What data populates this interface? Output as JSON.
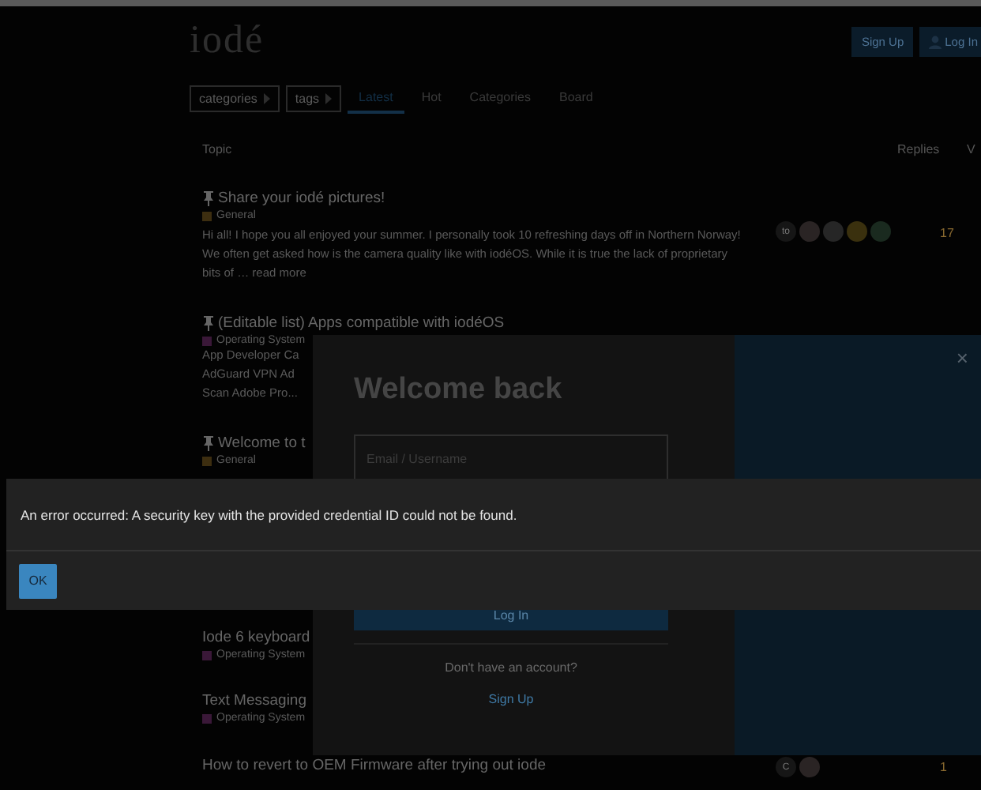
{
  "header": {
    "logo": "iodé",
    "buttons": [
      {
        "label": "Sign Up",
        "kind": "primary"
      },
      {
        "label": "Log In",
        "kind": "login"
      }
    ]
  },
  "nav": {
    "dropdowns": [
      "categories",
      "tags"
    ],
    "tabs": [
      {
        "label": "Latest",
        "selected": true
      },
      {
        "label": "Hot",
        "selected": false
      },
      {
        "label": "Categories",
        "selected": false
      },
      {
        "label": "Board",
        "selected": false
      }
    ]
  },
  "table": {
    "columns": [
      "Topic",
      "Replies",
      "V"
    ],
    "rows": [
      {
        "title": "Share your iodé pictures!",
        "pinned": true,
        "category": {
          "name": "General",
          "color": "#3d2e10"
        },
        "excerpt": "Hi all! I hope you all enjoyed your summer. I personally took 10 refreshing days off in Northern Norway! We often get asked how is the camera quality like with iodéOS. While it is true the lack of proprietary bits of … read more",
        "avatars": [
          {
            "kind": "letter",
            "text": "to"
          },
          {
            "kind": "image"
          },
          {
            "kind": "image"
          },
          {
            "kind": "image"
          },
          {
            "kind": "image"
          }
        ],
        "replies": "17"
      },
      {
        "title": "(Editable list) Apps compatible with iodéOS",
        "pinned": true,
        "category": {
          "name": "Operating System",
          "color": "#3a1838"
        },
        "excerpt_lines": [
          "App Developer Ca",
          "AdGuard VPN Ad",
          "Scan Adobe Pro..."
        ]
      },
      {
        "title": "Welcome to t",
        "pinned": true,
        "category": {
          "name": "General",
          "color": "#3d2e10"
        }
      },
      {
        "title": "Iode 6 keyboard",
        "pinned": false,
        "category": {
          "name": "Operating System",
          "color": "#3a1838"
        }
      },
      {
        "title": "Text Messaging",
        "pinned": false,
        "category": {
          "name": "Operating System",
          "color": "#3a1838"
        }
      },
      {
        "title": "How to revert to OEM Firmware after trying out iode",
        "pinned": false,
        "avatars": [
          {
            "kind": "letter",
            "text": "C"
          },
          {
            "kind": "image"
          }
        ],
        "replies": "1"
      }
    ]
  },
  "login_modal": {
    "close": "×",
    "title": "Welcome back",
    "field": {
      "placeholder": "Email / Username"
    },
    "submit": "Log In",
    "signup_prompt": "Don't have an account?",
    "signup_link": "Sign Up"
  },
  "error_dialog": {
    "message": "An error occurred: A security key with the provided credential ID could not be found.",
    "button": "OK"
  }
}
